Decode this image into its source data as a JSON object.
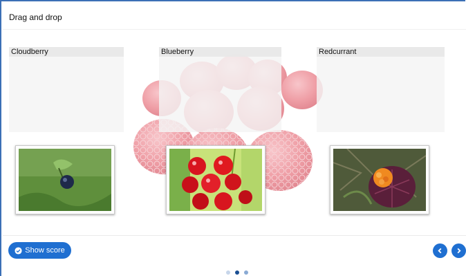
{
  "title": "Drag and drop",
  "drop_zones": [
    {
      "label": "Cloudberry"
    },
    {
      "label": "Blueberry"
    },
    {
      "label": "Redcurrant"
    }
  ],
  "draggables": [
    {
      "image": "blueberry-photo"
    },
    {
      "image": "redcurrant-photo"
    },
    {
      "image": "cloudberry-photo"
    }
  ],
  "footer": {
    "show_score_label": "Show score",
    "show_score_icon": "check-circle-icon",
    "prev_icon": "chevron-left-icon",
    "next_icon": "chevron-right-icon"
  },
  "pagination": {
    "total": 3,
    "current": 2
  },
  "colors": {
    "accent": "#1f6fd1",
    "frame": "#3b6fb6",
    "raspberry": "#e8707a"
  }
}
